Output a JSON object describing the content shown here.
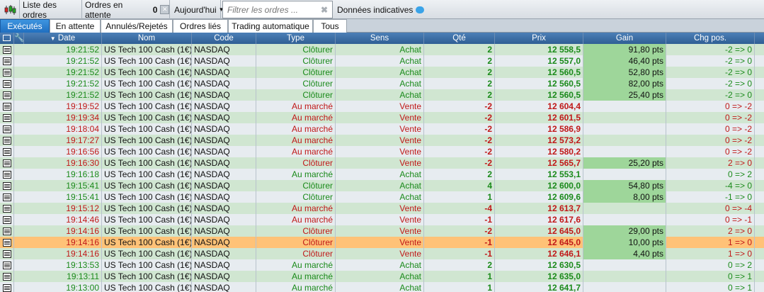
{
  "toolbar": {
    "list_label": "Liste des ordres",
    "pending_label": "Ordres en attente",
    "pending_count": "0",
    "period_label": "Aujourd'hui",
    "filter_placeholder": "Filtrer les ordres ...",
    "indicative_label": "Données indicatives"
  },
  "tabs": [
    {
      "label": "Exécutés",
      "active": true
    },
    {
      "label": "En attente",
      "active": false
    },
    {
      "label": "Annulés/Rejetés",
      "active": false
    },
    {
      "label": "Ordres liés",
      "active": false
    },
    {
      "label": "Trading automatique",
      "active": false
    },
    {
      "label": "Tous",
      "active": false
    }
  ],
  "columns": {
    "date": "Date",
    "nom": "Nom",
    "code": "Code",
    "type": "Type",
    "sens": "Sens",
    "qte": "Qté",
    "prix": "Prix",
    "gain": "Gain",
    "chg": "Chg pos."
  },
  "colors": {
    "buy": "#1a8a1a",
    "sell": "#c01818",
    "gain_bg": "#9ed69a",
    "selected_row": "#ffc277"
  },
  "rows": [
    {
      "time": "19:21:52",
      "name": "US Tech 100 Cash (1€)",
      "code": "NASDAQ",
      "type": "Clôturer",
      "side": "Achat",
      "qty": "2",
      "price": "12 558,5",
      "gain": "91,80 pts",
      "chg": "-2 => 0",
      "dir": "buy"
    },
    {
      "time": "19:21:52",
      "name": "US Tech 100 Cash (1€)",
      "code": "NASDAQ",
      "type": "Clôturer",
      "side": "Achat",
      "qty": "2",
      "price": "12 557,0",
      "gain": "46,40 pts",
      "chg": "-2 => 0",
      "dir": "buy"
    },
    {
      "time": "19:21:52",
      "name": "US Tech 100 Cash (1€)",
      "code": "NASDAQ",
      "type": "Clôturer",
      "side": "Achat",
      "qty": "2",
      "price": "12 560,5",
      "gain": "52,80 pts",
      "chg": "-2 => 0",
      "dir": "buy"
    },
    {
      "time": "19:21:52",
      "name": "US Tech 100 Cash (1€)",
      "code": "NASDAQ",
      "type": "Clôturer",
      "side": "Achat",
      "qty": "2",
      "price": "12 560,5",
      "gain": "82,00 pts",
      "chg": "-2 => 0",
      "dir": "buy"
    },
    {
      "time": "19:21:52",
      "name": "US Tech 100 Cash (1€)",
      "code": "NASDAQ",
      "type": "Clôturer",
      "side": "Achat",
      "qty": "2",
      "price": "12 560,5",
      "gain": "25,40 pts",
      "chg": "-2 => 0",
      "dir": "buy"
    },
    {
      "time": "19:19:52",
      "name": "US Tech 100 Cash (1€)",
      "code": "NASDAQ",
      "type": "Au marché",
      "side": "Vente",
      "qty": "-2",
      "price": "12 604,4",
      "gain": "",
      "chg": "0 => -2",
      "dir": "sell"
    },
    {
      "time": "19:19:34",
      "name": "US Tech 100 Cash (1€)",
      "code": "NASDAQ",
      "type": "Au marché",
      "side": "Vente",
      "qty": "-2",
      "price": "12 601,5",
      "gain": "",
      "chg": "0 => -2",
      "dir": "sell"
    },
    {
      "time": "19:18:04",
      "name": "US Tech 100 Cash (1€)",
      "code": "NASDAQ",
      "type": "Au marché",
      "side": "Vente",
      "qty": "-2",
      "price": "12 586,9",
      "gain": "",
      "chg": "0 => -2",
      "dir": "sell"
    },
    {
      "time": "19:17:27",
      "name": "US Tech 100 Cash (1€)",
      "code": "NASDAQ",
      "type": "Au marché",
      "side": "Vente",
      "qty": "-2",
      "price": "12 573,2",
      "gain": "",
      "chg": "0 => -2",
      "dir": "sell"
    },
    {
      "time": "19:16:56",
      "name": "US Tech 100 Cash (1€)",
      "code": "NASDAQ",
      "type": "Au marché",
      "side": "Vente",
      "qty": "-2",
      "price": "12 580,2",
      "gain": "",
      "chg": "0 => -2",
      "dir": "sell"
    },
    {
      "time": "19:16:30",
      "name": "US Tech 100 Cash (1€)",
      "code": "NASDAQ",
      "type": "Clôturer",
      "side": "Vente",
      "qty": "-2",
      "price": "12 565,7",
      "gain": "25,20 pts",
      "chg": "2 => 0",
      "dir": "sell"
    },
    {
      "time": "19:16:18",
      "name": "US Tech 100 Cash (1€)",
      "code": "NASDAQ",
      "type": "Au marché",
      "side": "Achat",
      "qty": "2",
      "price": "12 553,1",
      "gain": "",
      "chg": "0 => 2",
      "dir": "buy"
    },
    {
      "time": "19:15:41",
      "name": "US Tech 100 Cash (1€)",
      "code": "NASDAQ",
      "type": "Clôturer",
      "side": "Achat",
      "qty": "4",
      "price": "12 600,0",
      "gain": "54,80 pts",
      "chg": "-4 => 0",
      "dir": "buy"
    },
    {
      "time": "19:15:41",
      "name": "US Tech 100 Cash (1€)",
      "code": "NASDAQ",
      "type": "Clôturer",
      "side": "Achat",
      "qty": "1",
      "price": "12 609,6",
      "gain": "8,00 pts",
      "chg": "-1 => 0",
      "dir": "buy"
    },
    {
      "time": "19:15:12",
      "name": "US Tech 100 Cash (1€)",
      "code": "NASDAQ",
      "type": "Au marché",
      "side": "Vente",
      "qty": "-4",
      "price": "12 613,7",
      "gain": "",
      "chg": "0 => -4",
      "dir": "sell"
    },
    {
      "time": "19:14:46",
      "name": "US Tech 100 Cash (1€)",
      "code": "NASDAQ",
      "type": "Au marché",
      "side": "Vente",
      "qty": "-1",
      "price": "12 617,6",
      "gain": "",
      "chg": "0 => -1",
      "dir": "sell"
    },
    {
      "time": "19:14:16",
      "name": "US Tech 100 Cash (1€)",
      "code": "NASDAQ",
      "type": "Clôturer",
      "side": "Vente",
      "qty": "-2",
      "price": "12 645,0",
      "gain": "29,00 pts",
      "chg": "2 => 0",
      "dir": "sell"
    },
    {
      "time": "19:14:16",
      "name": "US Tech 100 Cash (1€)",
      "code": "NASDAQ",
      "type": "Clôturer",
      "side": "Vente",
      "qty": "-1",
      "price": "12 645,0",
      "gain": "10,00 pts",
      "chg": "1 => 0",
      "dir": "sell",
      "selected": true
    },
    {
      "time": "19:14:16",
      "name": "US Tech 100 Cash (1€)",
      "code": "NASDAQ",
      "type": "Clôturer",
      "side": "Vente",
      "qty": "-1",
      "price": "12 646,1",
      "gain": "4,40 pts",
      "chg": "1 => 0",
      "dir": "sell"
    },
    {
      "time": "19:13:53",
      "name": "US Tech 100 Cash (1€)",
      "code": "NASDAQ",
      "type": "Au marché",
      "side": "Achat",
      "qty": "2",
      "price": "12 630,5",
      "gain": "",
      "chg": "0 => 2",
      "dir": "buy"
    },
    {
      "time": "19:13:11",
      "name": "US Tech 100 Cash (1€)",
      "code": "NASDAQ",
      "type": "Au marché",
      "side": "Achat",
      "qty": "1",
      "price": "12 635,0",
      "gain": "",
      "chg": "0 => 1",
      "dir": "buy"
    },
    {
      "time": "19:13:00",
      "name": "US Tech 100 Cash (1€)",
      "code": "NASDAQ",
      "type": "Au marché",
      "side": "Achat",
      "qty": "1",
      "price": "12 641,7",
      "gain": "",
      "chg": "0 => 1",
      "dir": "buy"
    }
  ]
}
